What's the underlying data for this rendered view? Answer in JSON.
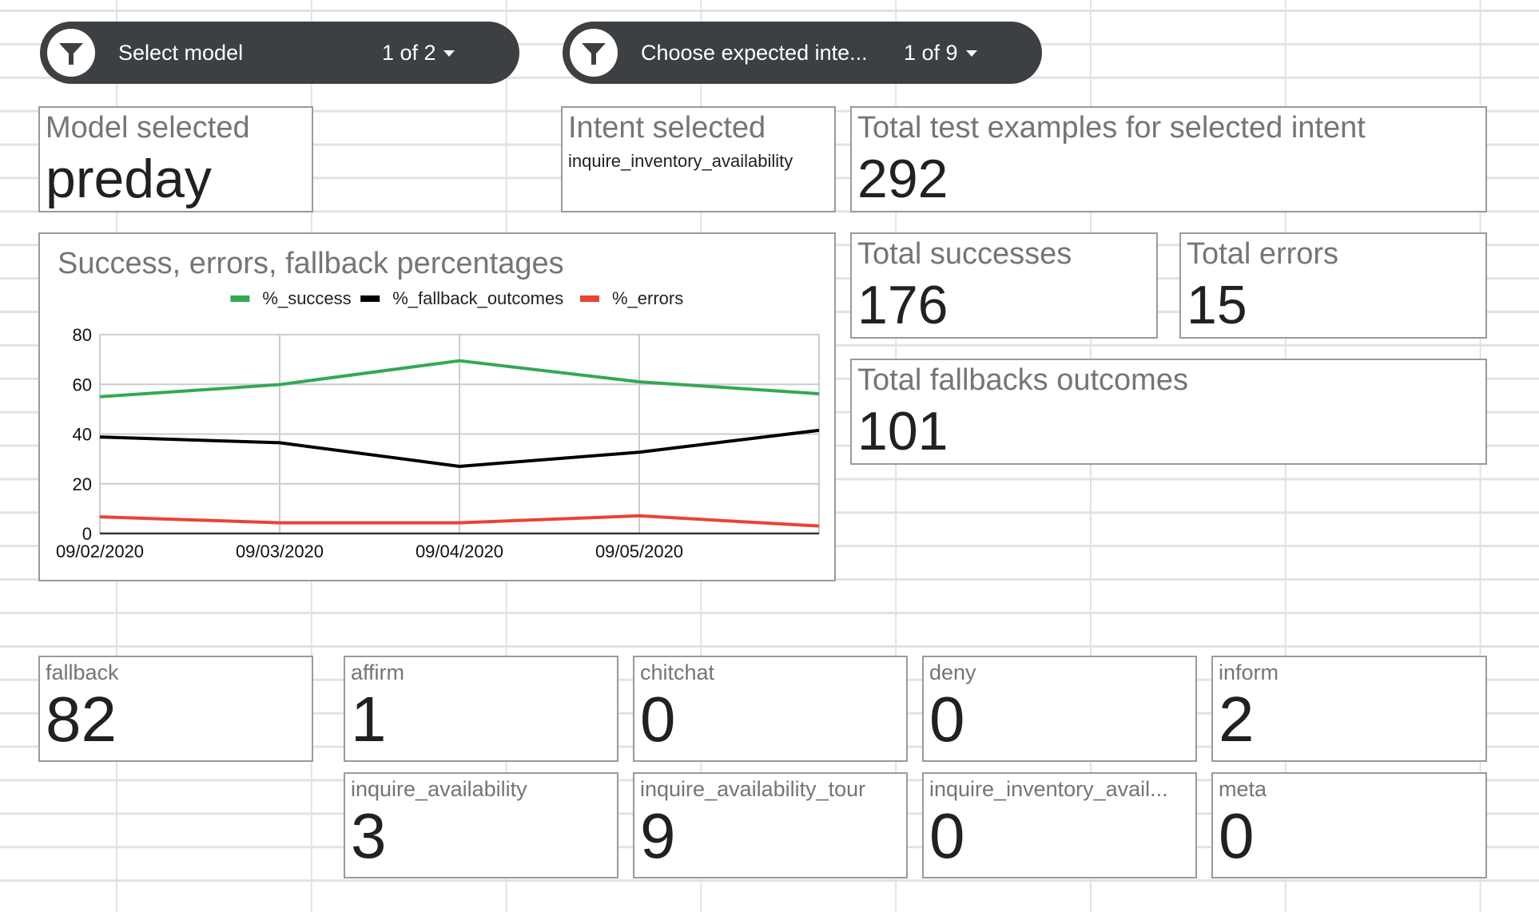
{
  "filters": [
    {
      "label": "Select model",
      "count": "1 of 2",
      "icon": "filter-funnel-icon"
    },
    {
      "label": "Choose expected inte...",
      "count": "1 of 9",
      "icon": "filter-funnel-icon"
    }
  ],
  "scorecards": {
    "model_selected": {
      "title": "Model selected",
      "value": "preday"
    },
    "intent_selected": {
      "title": "Intent selected",
      "value": "inquire_inventory_availability"
    },
    "total_examples": {
      "title": "Total test examples for selected intent",
      "value": "292"
    },
    "total_successes": {
      "title": "Total successes",
      "value": "176"
    },
    "total_errors": {
      "title": "Total errors",
      "value": "15"
    },
    "total_fallbacks": {
      "title": "Total fallbacks outcomes",
      "value": "101"
    }
  },
  "intent_counts": [
    {
      "title": "fallback",
      "value": "82"
    },
    {
      "title": "affirm",
      "value": "1"
    },
    {
      "title": "chitchat",
      "value": "0"
    },
    {
      "title": "deny",
      "value": "0"
    },
    {
      "title": "inform",
      "value": "2"
    },
    {
      "title": "inquire_availability",
      "value": "3"
    },
    {
      "title": "inquire_availability_tour",
      "value": "9"
    },
    {
      "title": "inquire_inventory_avail...",
      "value": "0"
    },
    {
      "title": "meta",
      "value": "0"
    }
  ],
  "chart_data": {
    "type": "line",
    "title": "Success, errors, fallback percentages",
    "xlabel": "",
    "ylabel": "",
    "x": [
      "09/02/2020",
      "09/03/2020",
      "09/04/2020",
      "09/05/2020",
      ""
    ],
    "ylim": [
      0,
      80
    ],
    "yticks": [
      0,
      20,
      40,
      60,
      80
    ],
    "grid": true,
    "legend_position": "top-center",
    "series": [
      {
        "name": "%_success",
        "color": "#34a853",
        "values": [
          55.0,
          59.9,
          69.5,
          61.0,
          56.2
        ]
      },
      {
        "name": "%_fallback_outcomes",
        "color": "#000000",
        "values": [
          38.8,
          36.5,
          27.0,
          32.7,
          41.5
        ]
      },
      {
        "name": "%_errors",
        "color": "#ea4335",
        "values": [
          6.7,
          4.3,
          4.3,
          7.1,
          3.0
        ]
      }
    ]
  }
}
